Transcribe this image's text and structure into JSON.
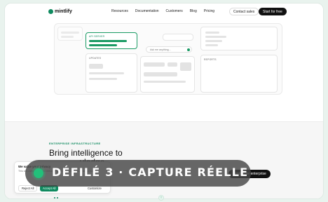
{
  "nav": {
    "brand": "mintlify",
    "links": [
      "Resources",
      "Documentation",
      "Customers",
      "Blog",
      "Pricing"
    ],
    "contact_sales": "Contact sales",
    "start_for_free": "Start for free"
  },
  "mockup": {
    "tag_api": "API SERVER",
    "tag_updates": "UPDATES",
    "tag_reports": "REPORTS",
    "ask_placeholder": "Ask me anything..."
  },
  "section": {
    "eyebrow": "ENTERPRISE INFRASTRUCTURE",
    "headline_1": "Bring intelligence to",
    "headline_2": "vledge",
    "explore_button": "Explore for enterprise"
  },
  "cookie": {
    "title": "We value your privacy",
    "text": "This site uses cookies to enhance your experience and analyze traffic.",
    "reject": "Reject All",
    "accept": "Accept All",
    "customize": "Customize"
  },
  "overlay": {
    "label": "DÉFILÉ 3 · CAPTURE RÉELLE"
  },
  "colors": {
    "brand_green": "#0f8a5f",
    "overlay_green": "#22c07a"
  }
}
